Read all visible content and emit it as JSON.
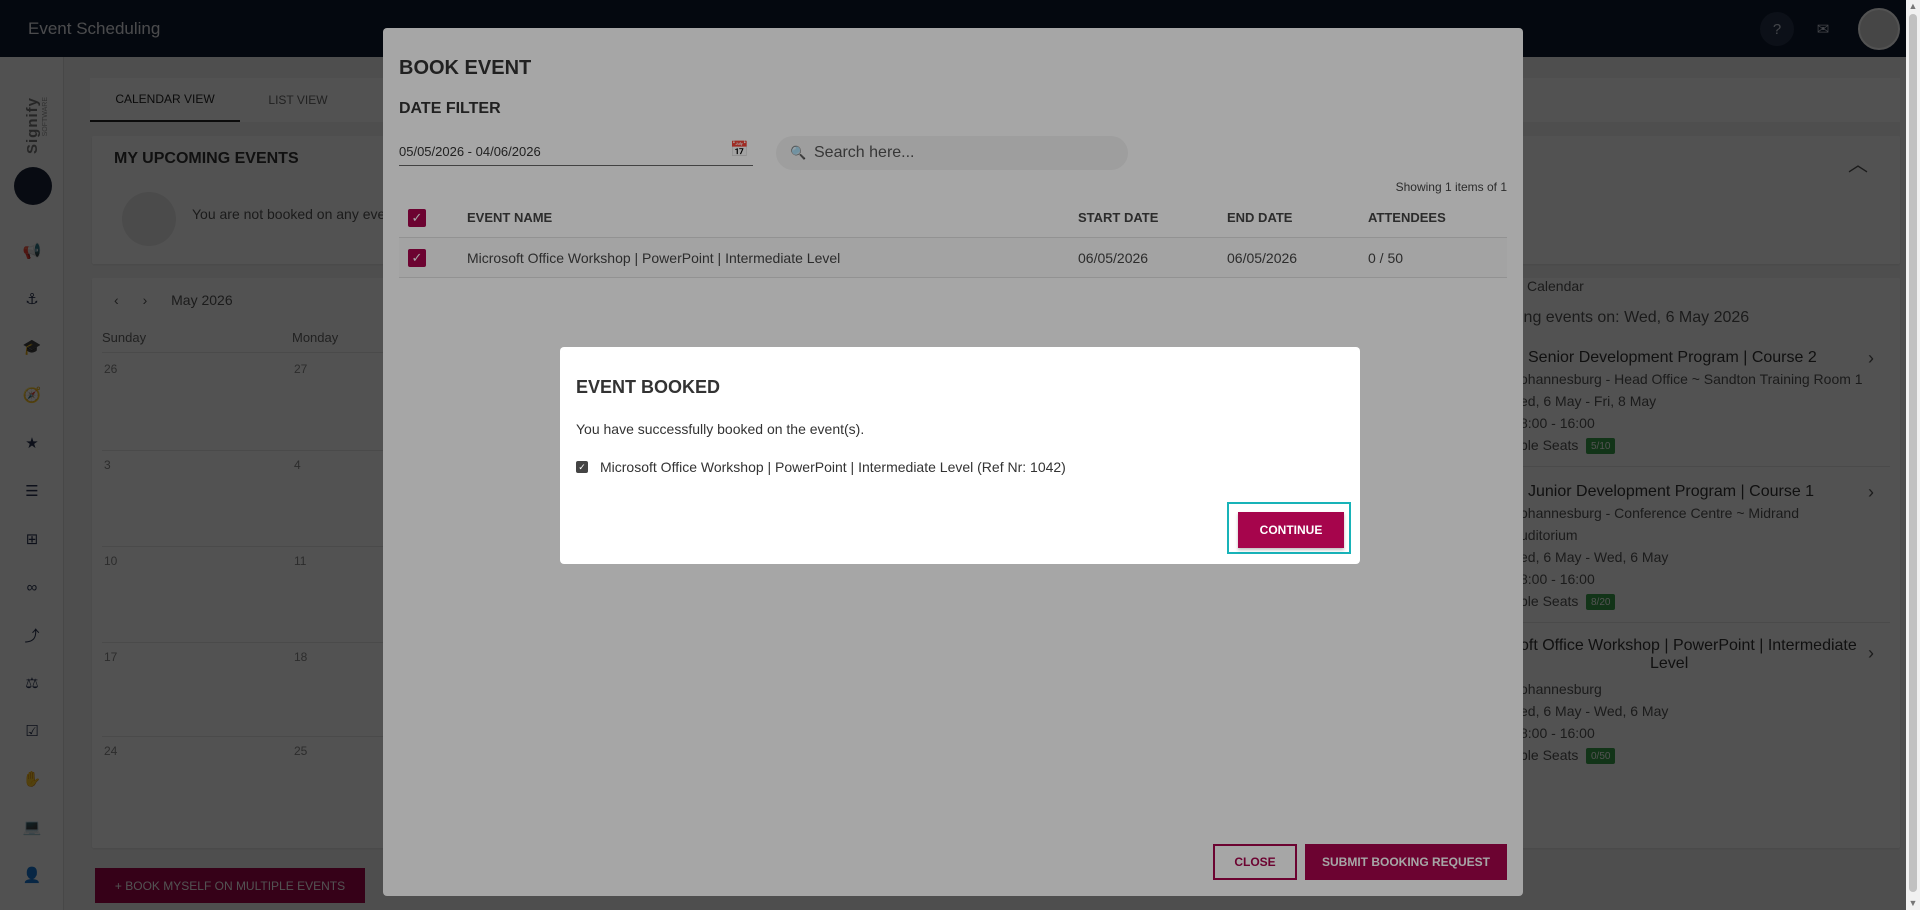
{
  "app": {
    "title": "Event Scheduling"
  },
  "topbar": {
    "help_icon": "?",
    "mail_icon": "✉"
  },
  "sidebar": {
    "brand": "Signify",
    "brand_sub": "SOFTWARE"
  },
  "tabs": [
    {
      "label": "CALENDAR VIEW"
    },
    {
      "label": "LIST VIEW"
    }
  ],
  "upcoming": {
    "title": "MY UPCOMING EVENTS",
    "empty_text": "You are not booked on any eve"
  },
  "calendar": {
    "month": "May 2026",
    "weekdays": [
      "Sunday",
      "Monday"
    ],
    "days": [
      "26",
      "27",
      "3",
      "4",
      "10",
      "11",
      "17",
      "18",
      "24",
      "25"
    ]
  },
  "side_list": {
    "header": "l Calendar",
    "date_label": "ing events on: Wed, 6 May 2026",
    "events": [
      {
        "title": "Senior Development Program | Course 2",
        "line1": "ohannesburg - Head Office ~ Sandton Training Room 1",
        "line2": "ed, 6 May - Fri, 8 May",
        "line3": "8:00 - 16:00",
        "seats_label": "ble Seats",
        "seats": "5/10"
      },
      {
        "title": "Junior Development Program | Course 1",
        "line1": "ohannesburg - Conference Centre ~ Midrand",
        "line1b": "uditorium",
        "line2": "ed, 6 May - Wed, 6 May",
        "line3": "8:00 - 16:00",
        "seats_label": "ble Seats",
        "seats": "8/20"
      },
      {
        "title": "soft Office Workshop | PowerPoint | Intermediate",
        "title2": "Level",
        "line1": "ohannesburg",
        "line2": "ed, 6 May - Wed, 6 May",
        "line3": "8:00 - 16:00",
        "seats_label": "ble Seats",
        "seats": "0/50"
      }
    ]
  },
  "book_multi_label": "+ BOOK MYSELF ON MULTIPLE EVENTS",
  "book_modal": {
    "title": "BOOK EVENT",
    "date_filter_label": "DATE FILTER",
    "date_range": "05/05/2026 - 04/06/2026",
    "search_placeholder": "Search here...",
    "showing": "Showing 1 items of 1",
    "columns": [
      "EVENT NAME",
      "START DATE",
      "END DATE",
      "ATTENDEES"
    ],
    "rows": [
      {
        "name": "Microsoft Office Workshop | PowerPoint | Intermediate Level",
        "start": "06/05/2026",
        "end": "06/05/2026",
        "attendees": "0 / 50"
      }
    ],
    "close_label": "CLOSE",
    "submit_label": "SUBMIT BOOKING REQUEST"
  },
  "booked_modal": {
    "title": "EVENT BOOKED",
    "message": "You have successfully booked on the event(s).",
    "item": "Microsoft Office Workshop | PowerPoint | Intermediate Level (Ref Nr: 1042)",
    "continue_label": "CONTINUE"
  },
  "colors": {
    "accent": "#a6054c",
    "topbar": "#0f1a2e",
    "focus_ring": "#18b3b8",
    "badge": "#3aa34a"
  }
}
